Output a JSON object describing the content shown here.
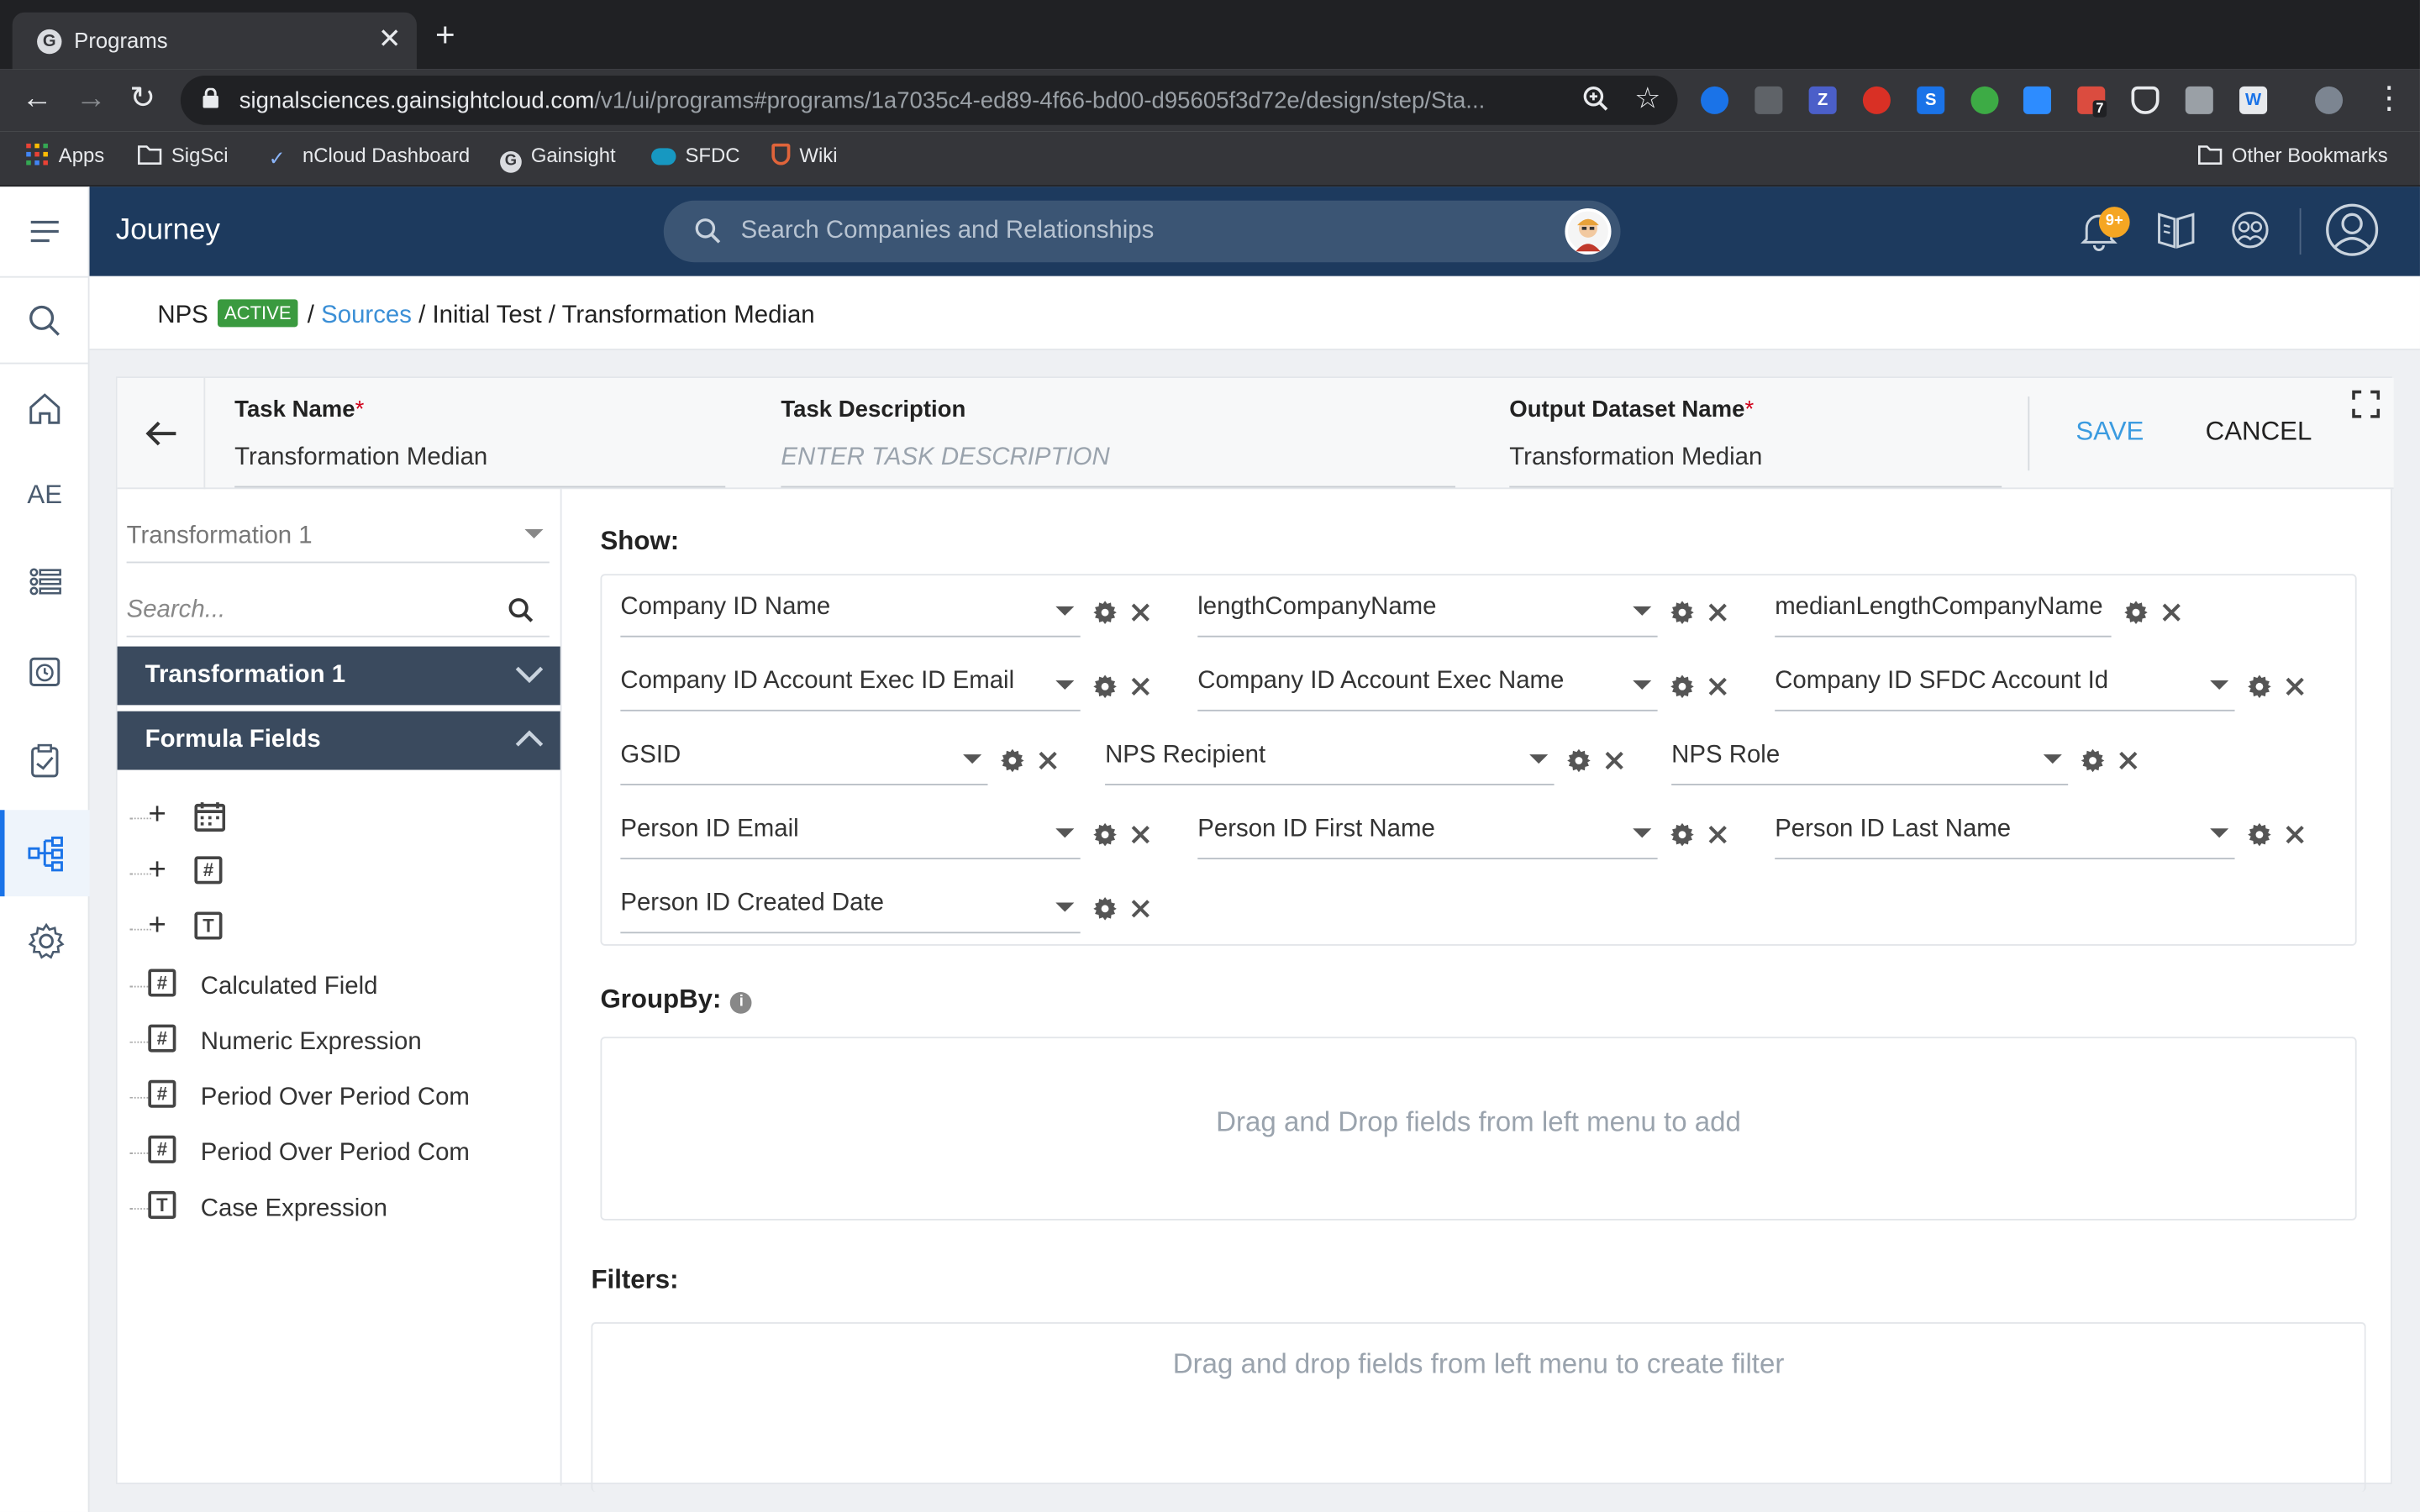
{
  "browser": {
    "tab_title": "Programs",
    "url_host": "signalsciences.gainsightcloud.com",
    "url_path": "/v1/ui/programs#programs/1a7035c4-ed89-4f66-bd00-d95605f3d72e/design/step/Sta...",
    "bookmarks": [
      "Apps",
      "SigSci",
      "nCloud Dashboard",
      "Gainsight",
      "SFDC",
      "Wiki"
    ],
    "other_bookmarks": "Other Bookmarks",
    "ext_badge": "7"
  },
  "app": {
    "title": "Journey",
    "search_placeholder": "Search Companies and Relationships",
    "notif_badge": "9+",
    "rail_ae": "AE"
  },
  "breadcrumb": {
    "program": "NPS",
    "status": "ACTIVE",
    "sep1": "/",
    "sources": "Sources",
    "rest": "/ Initial Test / Transformation Median"
  },
  "task": {
    "name_label": "Task Name",
    "name_value": "Transformation Median",
    "desc_label": "Task Description",
    "desc_placeholder": "ENTER TASK DESCRIPTION",
    "output_label": "Output Dataset Name",
    "output_value": "Transformation Median",
    "required_mark": "*",
    "save": "SAVE",
    "cancel": "CANCEL"
  },
  "left": {
    "selected": "Transformation 1",
    "search_placeholder": "Search...",
    "section1": "Transformation 1",
    "section2": "Formula Fields",
    "add_icons": [
      "calendar-icon",
      "number-icon",
      "text-icon"
    ],
    "formulas": [
      {
        "label": "Calculated Field",
        "icon": "#"
      },
      {
        "label": "Numeric Expression",
        "icon": "#"
      },
      {
        "label": "Period Over Period Com",
        "icon": "#"
      },
      {
        "label": "Period Over Period Com",
        "icon": "#"
      },
      {
        "label": "Case Expression",
        "icon": "T"
      }
    ]
  },
  "show": {
    "title": "Show:",
    "fields": [
      "Company ID Name",
      "lengthCompanyName",
      "medianLengthCompanyName",
      "Company ID Account Exec ID Email",
      "Company ID Account Exec Name",
      "Company ID SFDC Account Id",
      "GSID",
      "NPS Recipient",
      "NPS Role",
      "Person ID Email",
      "Person ID First Name",
      "Person ID Last Name",
      "Person ID Created Date"
    ]
  },
  "groupby": {
    "title": "GroupBy:",
    "info": "i",
    "placeholder": "Drag and Drop fields from left menu to add"
  },
  "filters": {
    "title": "Filters:",
    "placeholder": "Drag and drop fields from left menu to create filter"
  },
  "colors": {
    "appbar": "#1d3a5e",
    "accent": "#3b9be0",
    "active": "#3a9a3f",
    "section": "#3a4a5e"
  }
}
